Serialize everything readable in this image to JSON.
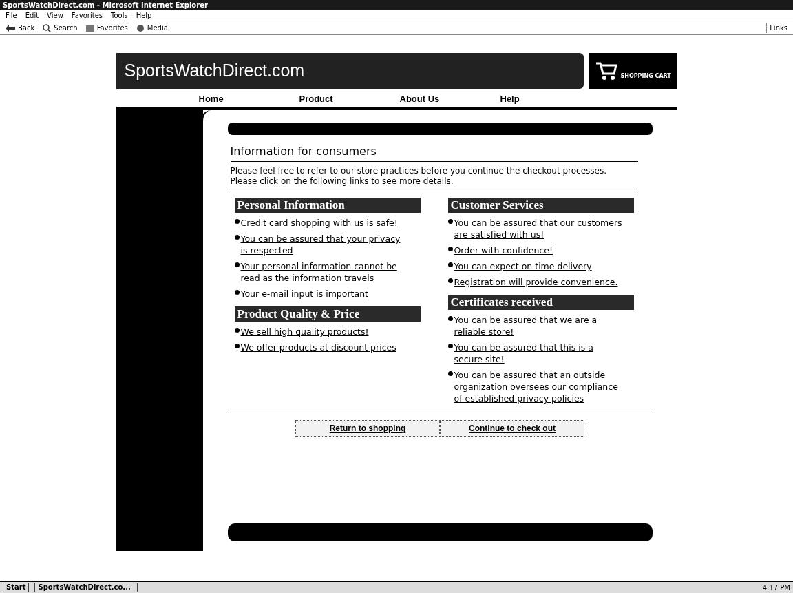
{
  "window": {
    "title": "SportsWatchDirect.com - Microsoft Internet Explorer"
  },
  "menu": [
    "File",
    "Edit",
    "View",
    "Favorites",
    "Tools",
    "Help"
  ],
  "toolbar": [
    {
      "kind": "back",
      "label": "Back"
    },
    {
      "kind": "search",
      "label": "Search"
    },
    {
      "kind": "favorites",
      "label": "Favorites"
    },
    {
      "kind": "media",
      "label": "Media"
    }
  ],
  "links_label": "Links",
  "site": {
    "logo": "SportsWatchDirect.com",
    "cart": "SHOPPING CART",
    "nav": [
      "Home",
      "Product",
      "About Us",
      "Help"
    ],
    "heading": "Information for consumers",
    "intro": "Please feel free to refer to our store practices before you continue the checkout processes. Please click on the following links to see more details.",
    "columns": [
      [
        {
          "title": "Personal Information",
          "links": [
            "Credit card shopping with us is safe!",
            "You can be assured that your privacy is respected",
            "Your personal information cannot be read as the information travels",
            "Your e-mail input is important"
          ]
        },
        {
          "title": "Product Quality & Price",
          "links": [
            "We sell high quality products!",
            "We offer products at discount prices"
          ]
        }
      ],
      [
        {
          "title": "Customer Services",
          "links": [
            "You can be assured that our customers are satisfied with us!",
            "Order with confidence!",
            "You can expect on time delivery",
            "Registration will provide convenience."
          ]
        },
        {
          "title": "Certificates received",
          "links": [
            "You can be assured that we are a reliable store!",
            "You can be assured that this is a secure site!",
            "You can be assured that an outside organization oversees our compliance of established privacy policies"
          ]
        }
      ]
    ],
    "buttons": [
      "Return to shopping",
      "Continue to check out"
    ]
  },
  "taskbar": {
    "start": "Start",
    "task": "SportsWatchDirect.co...",
    "time": "4:17 PM"
  }
}
